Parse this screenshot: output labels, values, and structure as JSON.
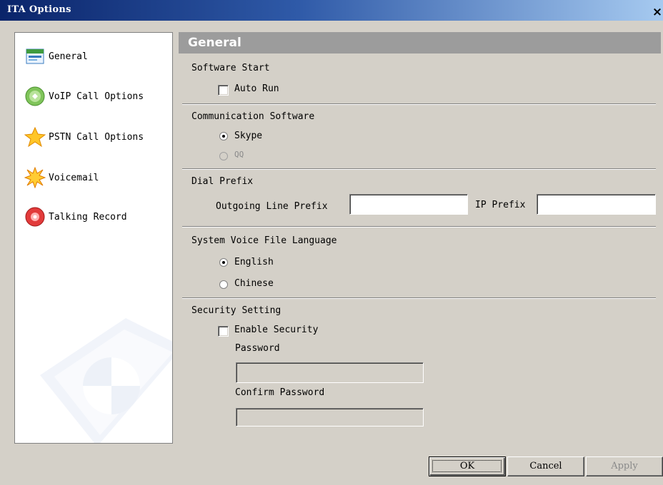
{
  "window": {
    "title": "ITA Options",
    "close_glyph": "×"
  },
  "sidebar": {
    "items": [
      {
        "label": "General",
        "icon": "general-icon"
      },
      {
        "label": "VoIP Call Options",
        "icon": "voip-icon"
      },
      {
        "label": "PSTN Call Options",
        "icon": "star-icon"
      },
      {
        "label": "Voicemail",
        "icon": "burst-icon"
      },
      {
        "label": "Talking Record",
        "icon": "record-icon"
      }
    ]
  },
  "panel": {
    "title": "General",
    "software_start": {
      "heading": "Software Start",
      "auto_run_label": "Auto Run",
      "auto_run_checked": false
    },
    "communication": {
      "heading": "Communication Software",
      "options": [
        {
          "label": "Skype",
          "selected": true,
          "enabled": true
        },
        {
          "label": "QQ",
          "selected": false,
          "enabled": false
        }
      ]
    },
    "dial_prefix": {
      "heading": "Dial Prefix",
      "outgoing_label": "Outgoing Line Prefix",
      "outgoing_value": "",
      "ip_label": "IP Prefix",
      "ip_value": ""
    },
    "voice_language": {
      "heading": "System Voice File Language",
      "options": [
        {
          "label": "English",
          "selected": true
        },
        {
          "label": "Chinese",
          "selected": false
        }
      ]
    },
    "security": {
      "heading": "Security Setting",
      "enable_label": "Enable Security",
      "enable_checked": false,
      "password_label": "Password",
      "password_value": "",
      "confirm_label": "Confirm Password",
      "confirm_value": ""
    }
  },
  "buttons": {
    "ok": "OK",
    "cancel": "Cancel",
    "apply": "Apply"
  }
}
